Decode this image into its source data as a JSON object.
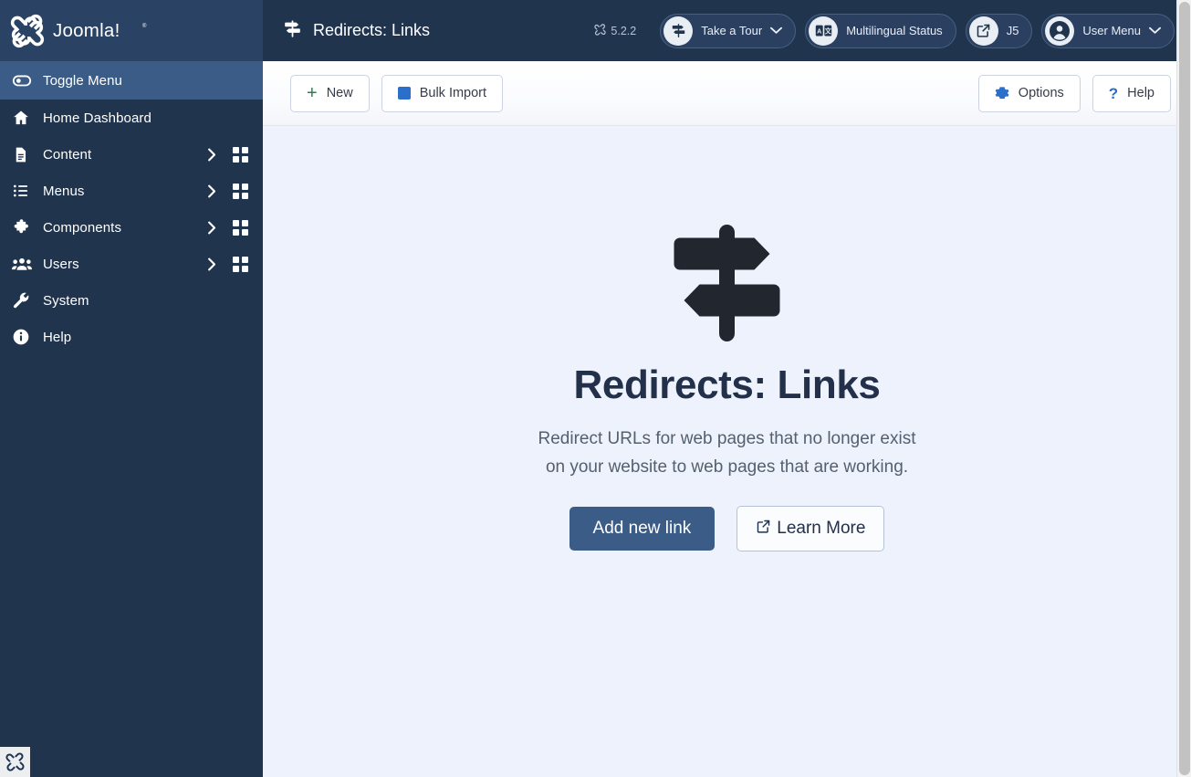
{
  "brand": {
    "name": "Joomla!",
    "logo_icon": "joomla-logo-icon",
    "favicon_icon": "joomla-favicon-icon"
  },
  "sidebar": {
    "items": [
      {
        "label": "Toggle Menu",
        "icon": "toggle-switch-icon",
        "active": true,
        "has_chevron": false,
        "has_grid": false
      },
      {
        "label": "Home Dashboard",
        "icon": "home-icon",
        "active": false,
        "has_chevron": false,
        "has_grid": false
      },
      {
        "label": "Content",
        "icon": "document-icon",
        "active": false,
        "has_chevron": true,
        "has_grid": true
      },
      {
        "label": "Menus",
        "icon": "list-icon",
        "active": false,
        "has_chevron": true,
        "has_grid": true
      },
      {
        "label": "Components",
        "icon": "puzzle-icon",
        "active": false,
        "has_chevron": true,
        "has_grid": true
      },
      {
        "label": "Users",
        "icon": "users-icon",
        "active": false,
        "has_chevron": true,
        "has_grid": true
      },
      {
        "label": "System",
        "icon": "wrench-icon",
        "active": false,
        "has_chevron": false,
        "has_grid": false
      },
      {
        "label": "Help",
        "icon": "info-circle-icon",
        "active": false,
        "has_chevron": false,
        "has_grid": false
      }
    ]
  },
  "header": {
    "title": "Redirects: Links",
    "title_icon": "signpost-icon",
    "version": "5.2.2",
    "version_icon": "joomla-mark-icon",
    "pills": [
      {
        "label": "Take a Tour",
        "icon": "signpost-icon",
        "caret": true
      },
      {
        "label": "Multilingual Status",
        "icon": "translate-icon",
        "caret": false
      },
      {
        "label": "J5",
        "icon": "external-link-icon",
        "caret": false
      },
      {
        "label": "User Menu",
        "icon": "user-circle-icon",
        "caret": true
      }
    ]
  },
  "toolbar": {
    "new_label": "New",
    "new_icon": "plus-icon",
    "bulk_import_label": "Bulk Import",
    "bulk_import_icon": "square-icon",
    "options_label": "Options",
    "options_icon": "gear-icon",
    "help_label": "Help",
    "help_icon": "question-icon"
  },
  "empty_state": {
    "illustration_icon": "signpost-illustration-icon",
    "title": "Redirects: Links",
    "description_line1": "Redirect URLs for web pages that no longer exist",
    "description_line2": "on your website to web pages that are working.",
    "primary_label": "Add new link",
    "secondary_label": "Learn More",
    "secondary_icon": "external-link-icon"
  },
  "colors": {
    "sidebar_bg": "#21344d",
    "sidebar_active": "#3a5c86",
    "header_bg": "#21344d",
    "content_bg": "#eef2fc",
    "accent_blue": "#2a6fc9",
    "primary_button": "#3a5c86",
    "green": "#287f50",
    "title_text": "#22304a"
  }
}
